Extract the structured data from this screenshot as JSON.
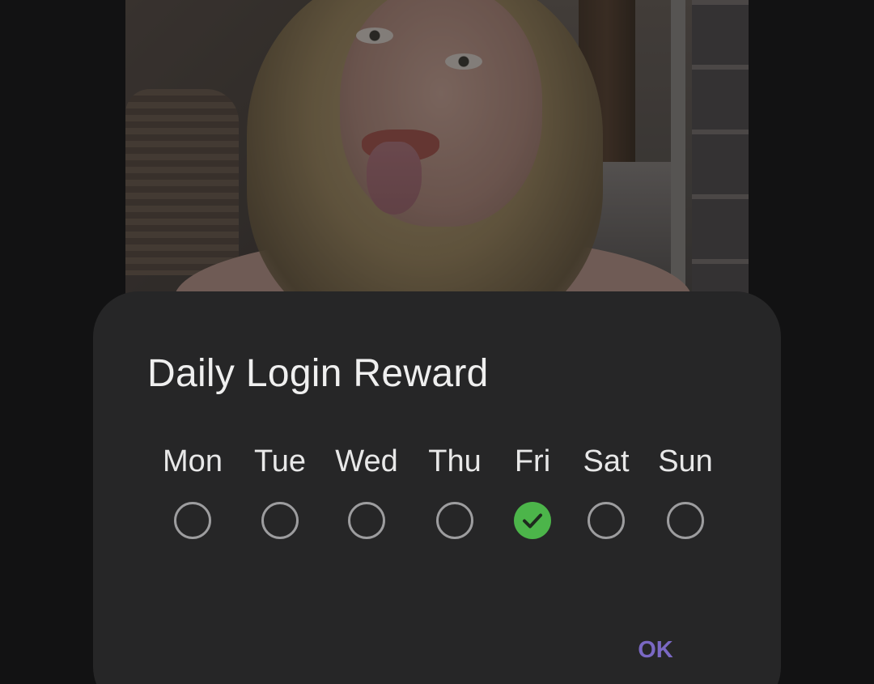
{
  "dialog": {
    "title": "Daily Login Reward",
    "ok_label": "OK",
    "accent_color": "#7a68c4",
    "check_color": "#4cb54a"
  },
  "days": [
    {
      "label": "Mon",
      "checked": false
    },
    {
      "label": "Tue",
      "checked": false
    },
    {
      "label": "Wed",
      "checked": false
    },
    {
      "label": "Thu",
      "checked": false
    },
    {
      "label": "Fri",
      "checked": true
    },
    {
      "label": "Sat",
      "checked": false
    },
    {
      "label": "Sun",
      "checked": false
    }
  ],
  "icons": {
    "checked": "check-circle-icon",
    "unchecked": "empty-circle-icon"
  }
}
